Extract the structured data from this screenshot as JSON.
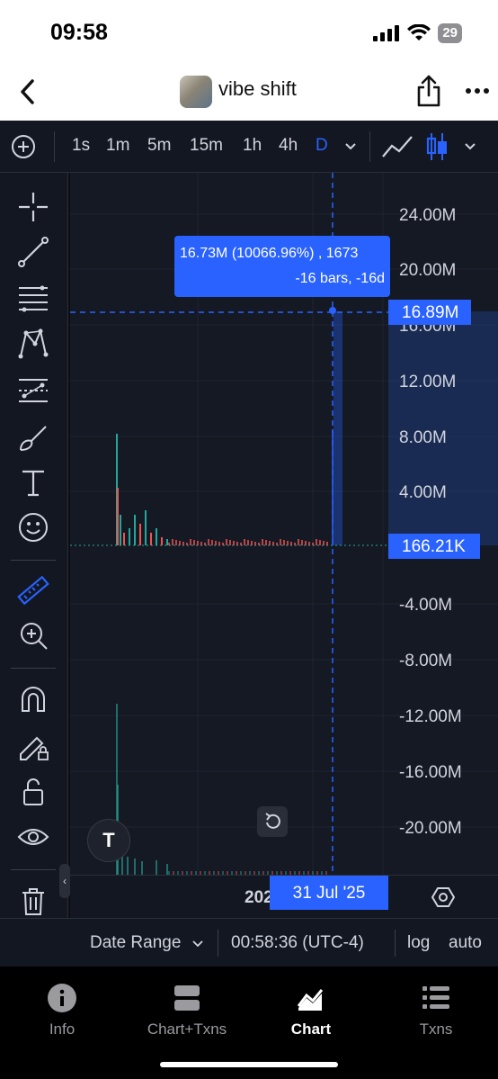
{
  "status": {
    "time": "09:58",
    "battery": "29"
  },
  "nav": {
    "title": "vibe shift"
  },
  "toolbar": {
    "timeframes": [
      "1s",
      "1m",
      "5m",
      "15m",
      "1h",
      "4h",
      "D"
    ],
    "active": "D"
  },
  "chart": {
    "price_labels": [
      "24.00M",
      "20.00M",
      "16.00M",
      "12.00M",
      "8.00M",
      "4.00M",
      "-4.00M",
      "-8.00M",
      "-12.00M",
      "-16.00M",
      "-20.00M"
    ],
    "measure": {
      "line1": "16.73M (10066.96%) , 1673",
      "line2": "-16 bars, -16d"
    },
    "crosshair_price": "16.89M",
    "last_price": "166.21K",
    "time_label": "2025",
    "crosshair_date": "31 Jul '25",
    "logo": "T"
  },
  "bottom_bar": {
    "date_range": "Date Range",
    "clock": "00:58:36 (UTC-4)",
    "log": "log",
    "auto": "auto"
  },
  "tabs": [
    {
      "label": "Info",
      "icon": "info-icon"
    },
    {
      "label": "Chart+Txns",
      "icon": "chart-txns-icon"
    },
    {
      "label": "Chart",
      "icon": "chart-icon",
      "active": true
    },
    {
      "label": "Txns",
      "icon": "txns-list-icon"
    }
  ],
  "colors": {
    "accent": "#2962ff",
    "up": "#26a69a",
    "down": "#ef5350"
  }
}
